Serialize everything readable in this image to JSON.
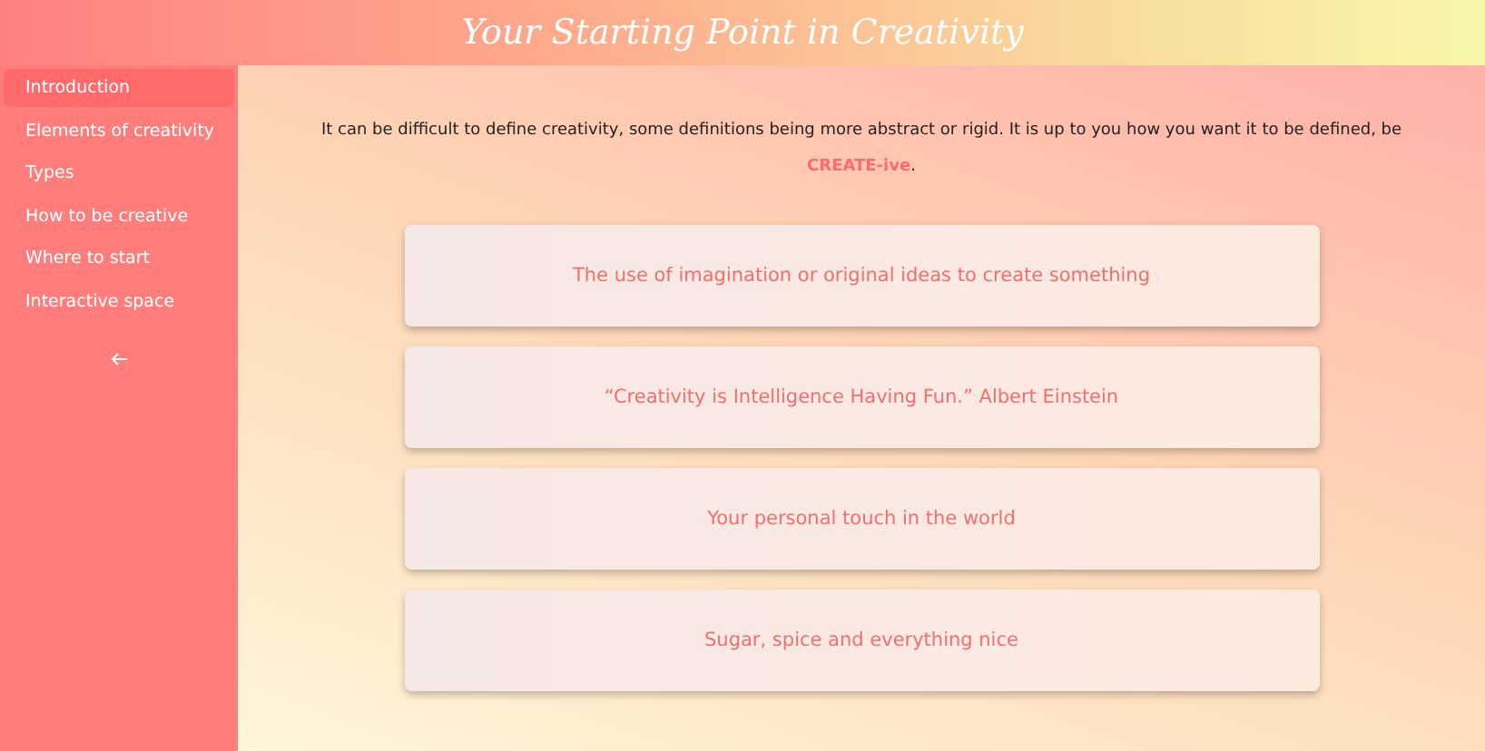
{
  "header": {
    "title": "Your Starting Point in Creativity"
  },
  "sidebar": {
    "items": [
      {
        "label": "Introduction",
        "selected": true
      },
      {
        "label": "Elements of creativity",
        "selected": false
      },
      {
        "label": "Types",
        "selected": false
      },
      {
        "label": "How to be creative",
        "selected": false
      },
      {
        "label": "Where to start",
        "selected": false
      },
      {
        "label": "Interactive space",
        "selected": false
      }
    ]
  },
  "intro": "It can be difficult to define creativity, some definitions being more abstract or rigid. It is up to you how you want it to be defined, be **CREATE-ive**.",
  "cards": [
    "The use of imagination or original ideas to create something",
    "“Creativity is Intelligence Having Fun.” Albert Einstein",
    "Your personal touch in the world",
    "Sugar, spice and everything nice"
  ]
}
